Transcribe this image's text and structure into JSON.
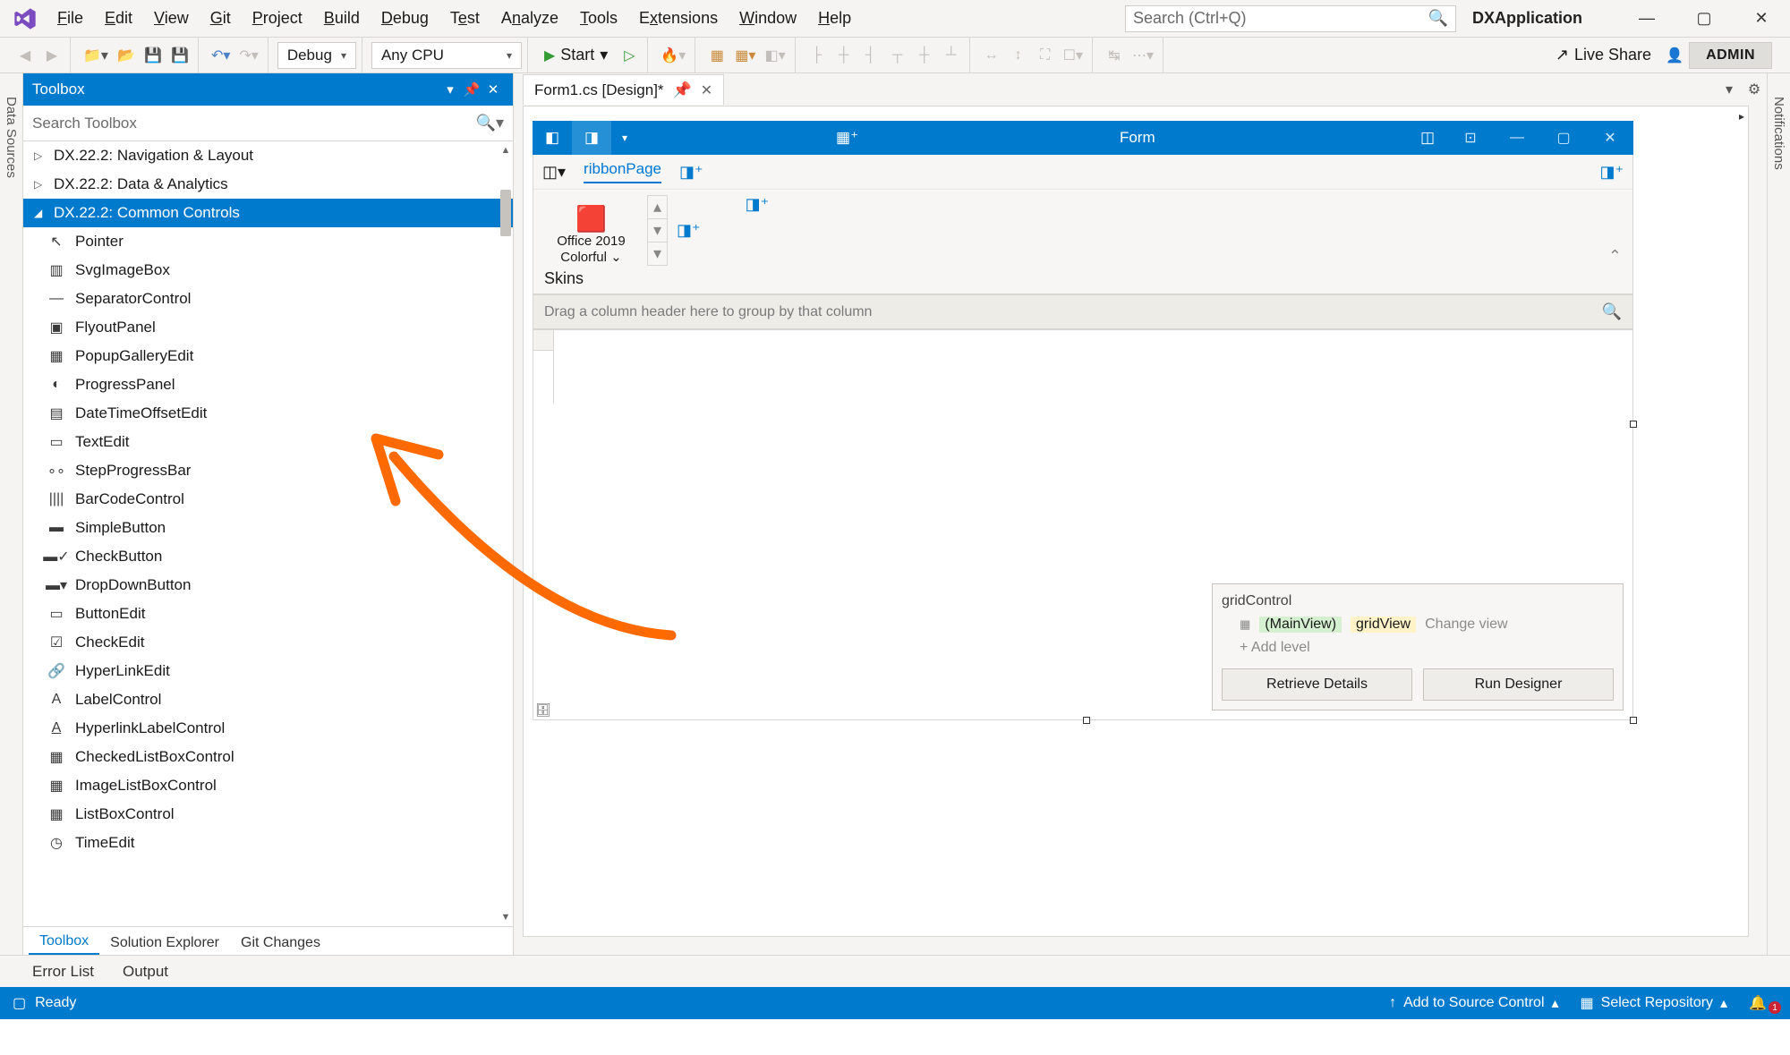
{
  "menu": [
    "File",
    "Edit",
    "View",
    "Git",
    "Project",
    "Build",
    "Debug",
    "Test",
    "Analyze",
    "Tools",
    "Extensions",
    "Window",
    "Help"
  ],
  "search_placeholder": "Search (Ctrl+Q)",
  "app_title": "DXApplication",
  "toolbar": {
    "config": "Debug",
    "platform": "Any CPU",
    "start": "Start",
    "liveshare": "Live Share",
    "admin": "ADMIN"
  },
  "side_left": "Data Sources",
  "side_right": "Notifications",
  "toolbox": {
    "title": "Toolbox",
    "search": "Search Toolbox",
    "categories": [
      {
        "label": "DX.22.2: Navigation & Layout",
        "expanded": false,
        "selected": false
      },
      {
        "label": "DX.22.2: Data & Analytics",
        "expanded": false,
        "selected": false
      },
      {
        "label": "DX.22.2: Common Controls",
        "expanded": true,
        "selected": true
      }
    ],
    "tools": [
      "Pointer",
      "SvgImageBox",
      "SeparatorControl",
      "FlyoutPanel",
      "PopupGalleryEdit",
      "ProgressPanel",
      "DateTimeOffsetEdit",
      "TextEdit",
      "StepProgressBar",
      "BarCodeControl",
      "SimpleButton",
      "CheckButton",
      "DropDownButton",
      "ButtonEdit",
      "CheckEdit",
      "HyperLinkEdit",
      "LabelControl",
      "HyperlinkLabelControl",
      "CheckedListBoxControl",
      "ImageListBoxControl",
      "ListBoxControl",
      "TimeEdit"
    ],
    "tabs": [
      "Toolbox",
      "Solution Explorer",
      "Git Changes"
    ]
  },
  "doc_tab": "Form1.cs [Design]*",
  "form": {
    "title": "Form",
    "ribbon_tab": "ribbonPage",
    "office_label1": "Office 2019",
    "office_label2": "Colorful",
    "group_caption": "Skins",
    "group_hint": "Drag a column header here to group by that column"
  },
  "grid_popup": {
    "header": "gridControl",
    "mainview": "(MainView)",
    "gridview": "gridView",
    "changeview": "Change view",
    "addlevel": "+ Add level",
    "btn1": "Retrieve Details",
    "btn2": "Run Designer"
  },
  "bottom_tabs": [
    "Error List",
    "Output"
  ],
  "status": {
    "ready": "Ready",
    "add_src": "Add to Source Control",
    "select_repo": "Select Repository",
    "bell_badge": "1"
  }
}
